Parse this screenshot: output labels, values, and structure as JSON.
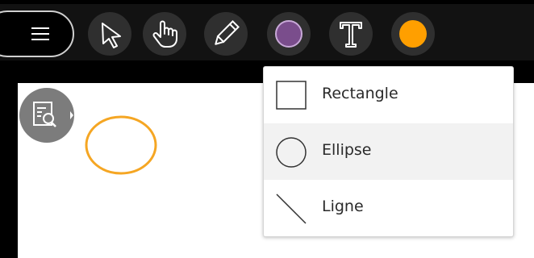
{
  "toolbar": {
    "tools": [
      {
        "name": "menu",
        "icon": "hamburger-menu-icon"
      },
      {
        "name": "select",
        "icon": "pointer-arrow-icon"
      },
      {
        "name": "pan",
        "icon": "hand-icon"
      },
      {
        "name": "draw",
        "icon": "pencil-icon"
      },
      {
        "name": "shape",
        "icon": "circle-shape-icon"
      },
      {
        "name": "text",
        "icon": "text-t-icon"
      },
      {
        "name": "color",
        "icon": "color-swatch-icon"
      }
    ],
    "shape_tool_color": "#7a4d8c",
    "active_color": "#ff9f00"
  },
  "shape_menu": {
    "items": [
      {
        "label": "Rectangle",
        "icon": "rectangle-icon"
      },
      {
        "label": "Ellipse",
        "icon": "ellipse-icon"
      },
      {
        "label": "Ligne",
        "icon": "line-icon"
      }
    ],
    "selected": "Ellipse"
  },
  "canvas": {
    "background": "#ffffff",
    "drawn_shape_color": "#f5a623",
    "search_button_icon": "search-document-icon"
  }
}
